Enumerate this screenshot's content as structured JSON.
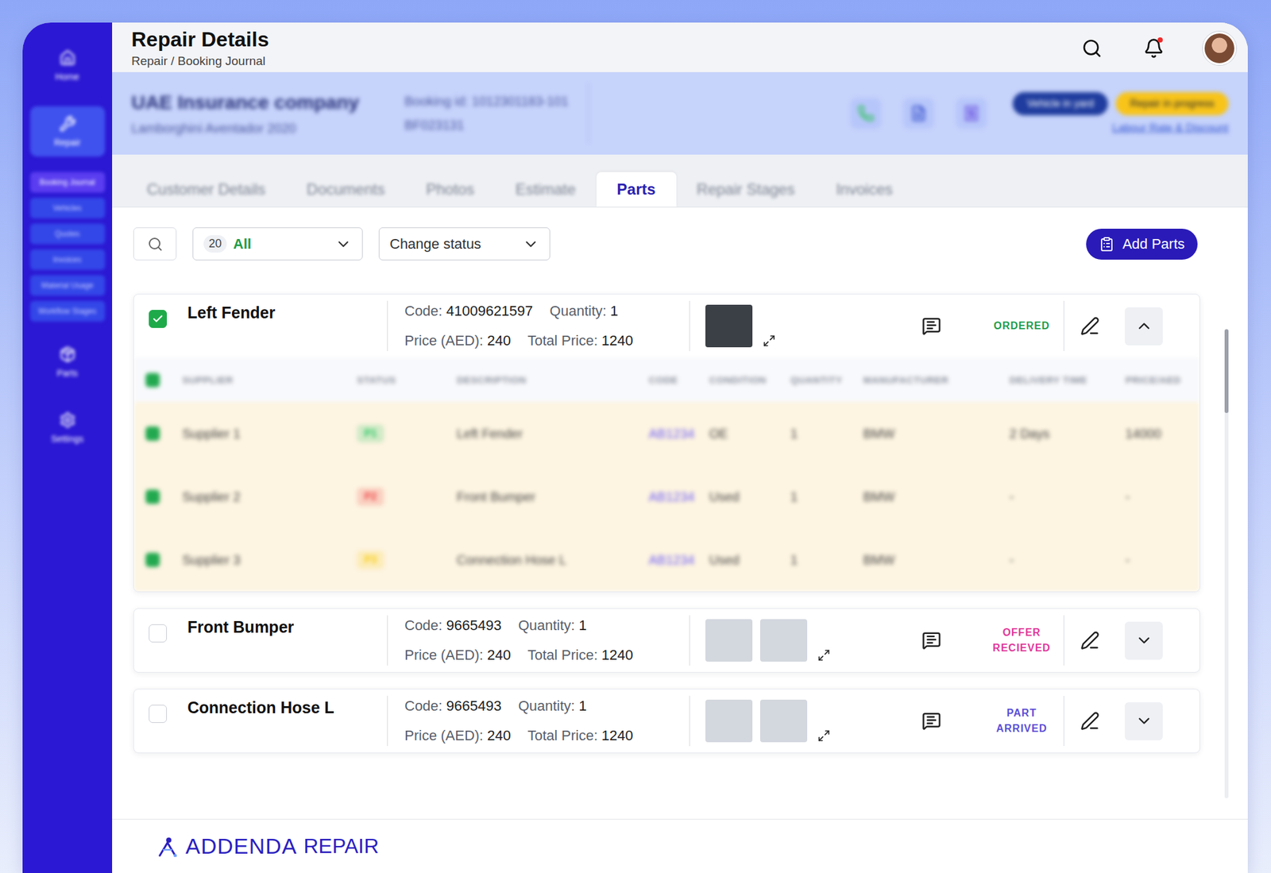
{
  "header": {
    "title": "Repair Details",
    "breadcrumb": "Repair / Booking Journal",
    "notifications": true
  },
  "sidebar": {
    "items": [
      {
        "label": "Home",
        "selected": false,
        "children": []
      },
      {
        "label": "Repair",
        "selected": true,
        "children": [
          {
            "label": "Booking Journal",
            "selected": true
          },
          {
            "label": "Vehicles",
            "selected": false
          },
          {
            "label": "Quotes",
            "selected": false
          },
          {
            "label": "Invoices",
            "selected": false
          },
          {
            "label": "Material Usage",
            "selected": false
          },
          {
            "label": "Workflow Stages",
            "selected": false
          }
        ]
      },
      {
        "label": "Parts",
        "selected": false,
        "children": []
      },
      {
        "label": "Settings",
        "selected": false,
        "children": []
      }
    ]
  },
  "booking": {
    "company": "UAE Insurance company",
    "vehicle": "Lamborghini Aventador 2020",
    "booking_id": "Booking id: 1012301183-101",
    "plate": "BF023131",
    "badges": [
      {
        "label": "Vehicle in yard",
        "color": "#1f3c9e"
      },
      {
        "label": "Repair in progress",
        "color": "#f8c41a"
      }
    ],
    "link": "Labour Rate & Discount"
  },
  "tabs": [
    {
      "label": "Customer Details",
      "selected": false
    },
    {
      "label": "Documents",
      "selected": false
    },
    {
      "label": "Photos",
      "selected": false
    },
    {
      "label": "Estimate",
      "selected": false
    },
    {
      "label": "Parts",
      "selected": true
    },
    {
      "label": "Repair Stages",
      "selected": false
    },
    {
      "label": "Invoices",
      "selected": false
    }
  ],
  "toolbar": {
    "count": "20",
    "filter": "All",
    "status_select": "Change status",
    "add_button": "Add Parts"
  },
  "offer_columns": [
    "SUPPLIER",
    "STATUS",
    "DESCRIPTION",
    "CODE",
    "CONDITION",
    "QUANTITY",
    "MANUFACTURER",
    "DELIVERY TIME",
    "PRICE/AED"
  ],
  "parts": [
    {
      "name": "Left Fender",
      "checked": true,
      "expanded": true,
      "code_label": "Code:",
      "code": "41009621597",
      "quantity_label": "Quantity:",
      "quantity": "1",
      "price_label": "Price (AED):",
      "price": "240",
      "total_label": "Total Price:",
      "total": "1240",
      "photo_count": 1,
      "status": "ORDERED",
      "color": "#1f9d4a",
      "offers_all_checked": true,
      "offers": [
        {
          "checked": true,
          "supplier": "Supplier 1",
          "status": "P1",
          "color": "#22c55e",
          "description": "Left Fender",
          "code": "AB1234",
          "condition": "OE",
          "quantity": "1",
          "manufacturer": "BMW",
          "delivery": "2 Days",
          "price": "14000"
        },
        {
          "checked": true,
          "supplier": "Supplier 2",
          "status": "P2",
          "color": "#ef4444",
          "description": "Front Bumper",
          "code": "AB1234",
          "condition": "Used",
          "quantity": "1",
          "manufacturer": "BMW",
          "delivery": "-",
          "price": "-"
        },
        {
          "checked": true,
          "supplier": "Supplier 3",
          "status": "P3",
          "color": "#facc15",
          "description": "Connection Hose L",
          "code": "AB1234",
          "condition": "Used",
          "quantity": "1",
          "manufacturer": "BMW",
          "delivery": "-",
          "price": "-"
        }
      ]
    },
    {
      "name": "Front Bumper",
      "checked": false,
      "expanded": false,
      "code_label": "Code:",
      "code": "9665493",
      "quantity_label": "Quantity:",
      "quantity": "1",
      "price_label": "Price (AED):",
      "price": "240",
      "total_label": "Total Price:",
      "total": "1240",
      "photo_count": 2,
      "status": "OFFER RECIEVED",
      "color": "#e0399a",
      "offers_all_checked": false,
      "offers": []
    },
    {
      "name": "Connection Hose L",
      "checked": false,
      "expanded": false,
      "code_label": "Code:",
      "code": "9665493",
      "quantity_label": "Quantity:",
      "quantity": "1",
      "price_label": "Price (AED):",
      "price": "240",
      "total_label": "Total Price:",
      "total": "1240",
      "photo_count": 2,
      "status": "PART ARRIVED",
      "color": "#5b4fd6",
      "offers_all_checked": false,
      "offers": []
    }
  ],
  "footer": {
    "brand": "ADDENDA",
    "product": "REPAIR"
  }
}
